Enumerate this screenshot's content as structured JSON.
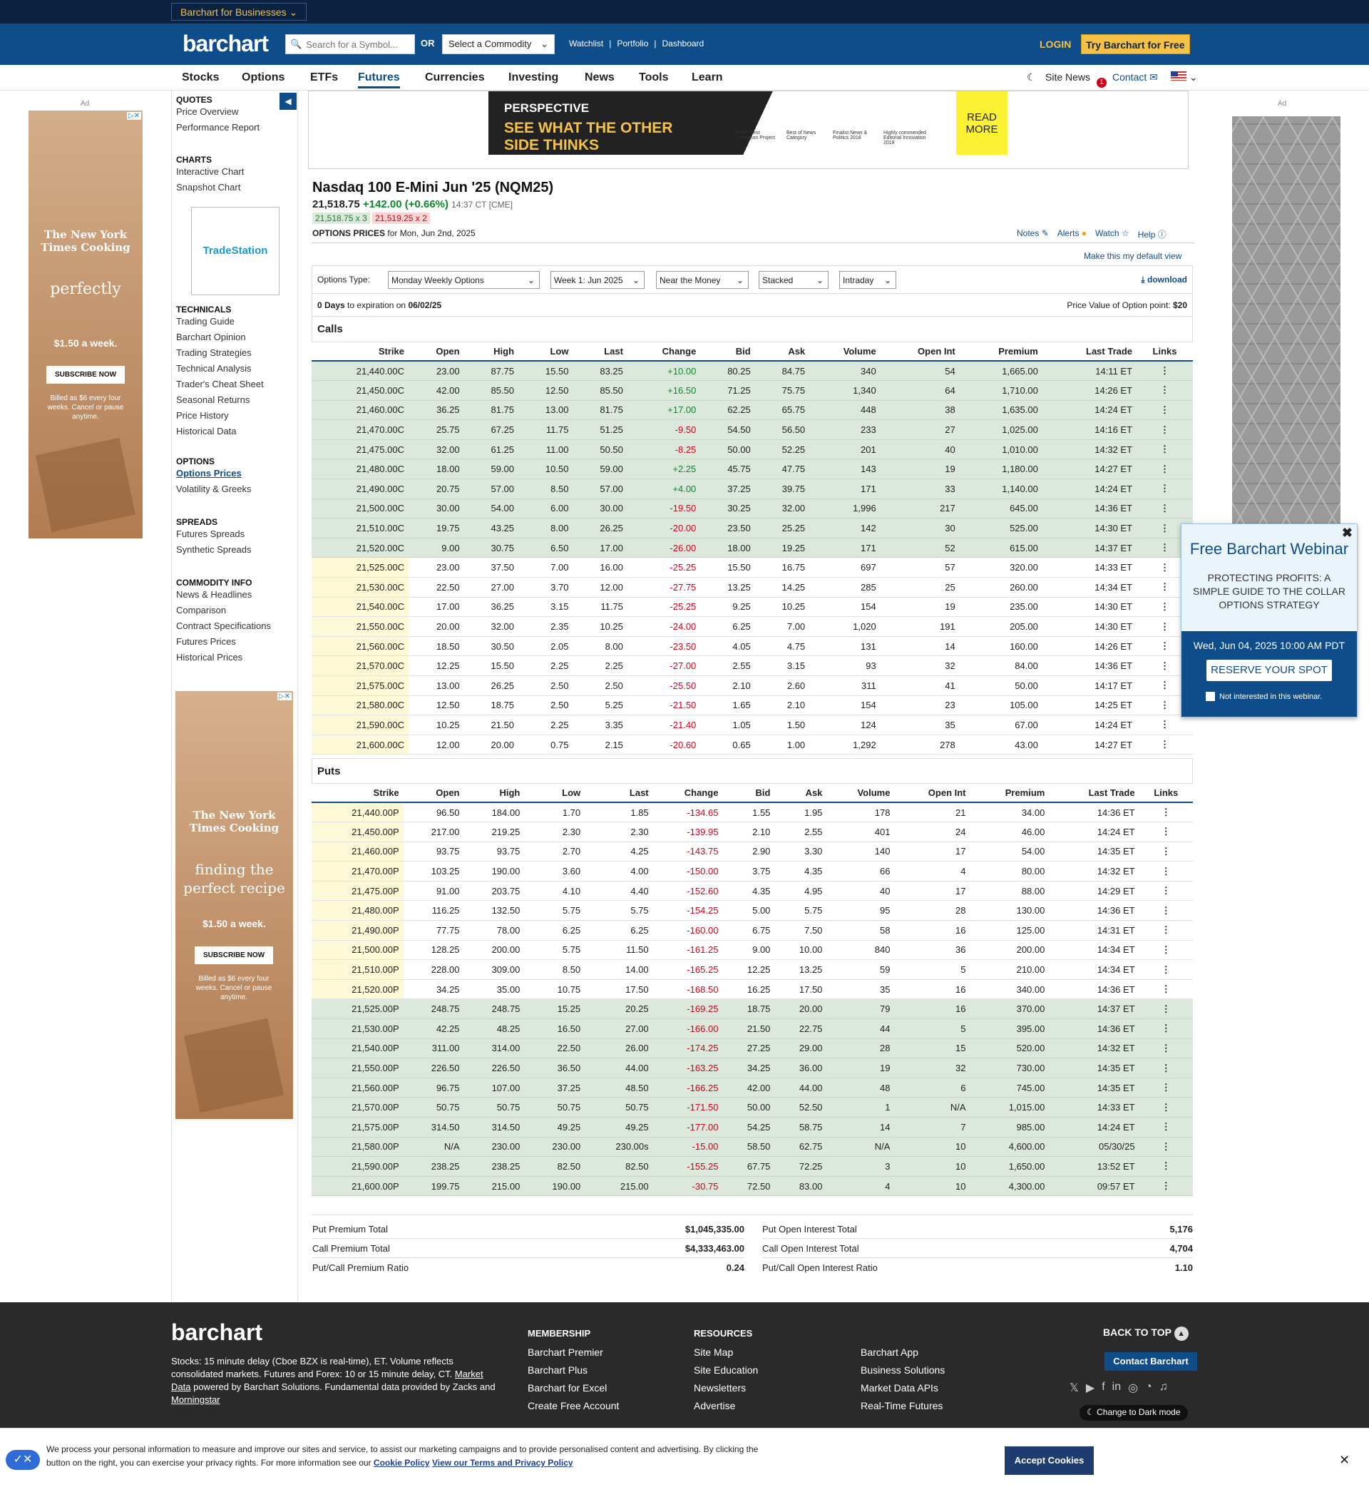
{
  "topbar": {
    "business_label": "Barchart for Businesses"
  },
  "header": {
    "logo": "barchart",
    "search_placeholder": "Search for a Symbol...",
    "or_label": "OR",
    "commodity_select": "Select a Commodity",
    "links": [
      "Watchlist",
      "Portfolio",
      "Dashboard"
    ],
    "login": "LOGIN",
    "try_free": "Try Barchart for Free"
  },
  "nav": {
    "items": [
      "Stocks",
      "Options",
      "ETFs",
      "Futures",
      "Currencies",
      "Investing",
      "News",
      "Tools",
      "Learn"
    ],
    "site_news": "Site News",
    "site_news_badge": "1",
    "contact": "Contact"
  },
  "ads": {
    "label": "Ad",
    "left_brand": "The New York Times Cooking",
    "left_word": "perfectly",
    "left_price": "$1.50 a week.",
    "left_subscribe": "SUBSCRIBE NOW",
    "left_billed": "Billed as $6 every four weeks. Cancel or pause anytime.",
    "mid_brand": "The New York Times Cooking",
    "mid_word1": "finding the",
    "mid_word2": "perfect recipe",
    "mid_price": "$1.50 a week.",
    "mid_subscribe": "SUBSCRIBE NOW",
    "mid_billed": "Billed as $6 every four weeks. Cancel or pause anytime.",
    "tradestation": "TradeStation",
    "banner_brand": "PERSPECTIVE",
    "banner_line1": "SEE WHAT THE OTHER",
    "banner_line2": "SIDE THINKS",
    "banner_awards": [
      "EPPY Best Innovation Project",
      "Best of News Category",
      "Finalist News & Politics 2018",
      "Highly commended Editorial Innovation 2018"
    ],
    "banner_cta": "READ MORE"
  },
  "sidebar": {
    "sections": [
      {
        "title": "QUOTES",
        "items": [
          "Price Overview",
          "Performance Report"
        ]
      },
      {
        "title": "CHARTS",
        "items": [
          "Interactive Chart",
          "Snapshot Chart"
        ]
      },
      {
        "title": "TECHNICALS",
        "items": [
          "Trading Guide",
          "Barchart Opinion",
          "Trading Strategies",
          "Technical Analysis",
          "Trader's Cheat Sheet",
          "Seasonal Returns",
          "Price History",
          "Historical Data"
        ]
      },
      {
        "title": "OPTIONS",
        "items": [
          "Options Prices",
          "Volatility & Greeks"
        ]
      },
      {
        "title": "SPREADS",
        "items": [
          "Futures Spreads",
          "Synthetic Spreads"
        ]
      },
      {
        "title": "COMMODITY INFO",
        "items": [
          "News & Headlines",
          "Comparison",
          "Contract Specifications",
          "Futures Prices",
          "Historical Prices"
        ]
      }
    ]
  },
  "quote": {
    "title": "Nasdaq 100 E-Mini Jun '25 (NQM25)",
    "price": "21,518.75",
    "change": "+142.00 (+0.66%)",
    "time": "14:37 CT [CME]",
    "bid": "21,518.75 x 3",
    "ask": "21,519.25 x 2",
    "options_prices_label": "OPTIONS PRICES",
    "options_date": "for Mon, Jun 2nd, 2025",
    "tools": [
      "Notes",
      "Alerts",
      "Watch",
      "Help"
    ],
    "default_view": "Make this my default view"
  },
  "filters": {
    "type_label": "Options Type:",
    "type": "Monday Weekly Options",
    "expiry": "Week 1: Jun 2025",
    "money": "Near the Money",
    "layout": "Stacked",
    "interval": "Intraday",
    "download": "download",
    "days": "0 Days",
    "expiration_text": "to expiration on",
    "expiration_date": "06/02/25",
    "price_value_label": "Price Value of Option point:",
    "price_value": "$20"
  },
  "calls": {
    "title": "Calls",
    "headers": [
      "Strike",
      "Open",
      "High",
      "Low",
      "Last",
      "Change",
      "Bid",
      "Ask",
      "Volume",
      "Open Int",
      "Premium",
      "Last Trade",
      "Links"
    ],
    "rows": [
      [
        "21,440.00C",
        "23.00",
        "87.75",
        "15.50",
        "83.25",
        "+10.00",
        "80.25",
        "84.75",
        "340",
        "54",
        "1,665.00",
        "14:11 ET"
      ],
      [
        "21,450.00C",
        "42.00",
        "85.50",
        "12.50",
        "85.50",
        "+16.50",
        "71.25",
        "75.75",
        "1,340",
        "64",
        "1,710.00",
        "14:26 ET"
      ],
      [
        "21,460.00C",
        "36.25",
        "81.75",
        "13.00",
        "81.75",
        "+17.00",
        "62.25",
        "65.75",
        "448",
        "38",
        "1,635.00",
        "14:24 ET"
      ],
      [
        "21,470.00C",
        "25.75",
        "67.25",
        "11.75",
        "51.25",
        "-9.50",
        "54.50",
        "56.50",
        "233",
        "27",
        "1,025.00",
        "14:16 ET"
      ],
      [
        "21,475.00C",
        "32.00",
        "61.25",
        "11.00",
        "50.50",
        "-8.25",
        "50.00",
        "52.25",
        "201",
        "40",
        "1,010.00",
        "14:32 ET"
      ],
      [
        "21,480.00C",
        "18.00",
        "59.00",
        "10.50",
        "59.00",
        "+2.25",
        "45.75",
        "47.75",
        "143",
        "19",
        "1,180.00",
        "14:27 ET"
      ],
      [
        "21,490.00C",
        "20.75",
        "57.00",
        "8.50",
        "57.00",
        "+4.00",
        "37.25",
        "39.75",
        "171",
        "33",
        "1,140.00",
        "14:24 ET"
      ],
      [
        "21,500.00C",
        "30.00",
        "54.00",
        "6.00",
        "30.00",
        "-19.50",
        "30.25",
        "32.00",
        "1,996",
        "217",
        "645.00",
        "14:36 ET"
      ],
      [
        "21,510.00C",
        "19.75",
        "43.25",
        "8.00",
        "26.25",
        "-20.00",
        "23.50",
        "25.25",
        "142",
        "30",
        "525.00",
        "14:30 ET"
      ],
      [
        "21,520.00C",
        "9.00",
        "30.75",
        "6.50",
        "17.00",
        "-26.00",
        "18.00",
        "19.25",
        "171",
        "52",
        "615.00",
        "14:37 ET"
      ],
      [
        "21,525.00C",
        "23.00",
        "37.50",
        "7.00",
        "16.00",
        "-25.25",
        "15.50",
        "16.75",
        "697",
        "57",
        "320.00",
        "14:33 ET"
      ],
      [
        "21,530.00C",
        "22.50",
        "27.00",
        "3.70",
        "12.00",
        "-27.75",
        "13.25",
        "14.25",
        "285",
        "25",
        "260.00",
        "14:34 ET"
      ],
      [
        "21,540.00C",
        "17.00",
        "36.25",
        "3.15",
        "11.75",
        "-25.25",
        "9.25",
        "10.25",
        "154",
        "19",
        "235.00",
        "14:30 ET"
      ],
      [
        "21,550.00C",
        "20.00",
        "32.00",
        "2.35",
        "10.25",
        "-24.00",
        "6.25",
        "7.00",
        "1,020",
        "191",
        "205.00",
        "14:30 ET"
      ],
      [
        "21,560.00C",
        "18.50",
        "30.50",
        "2.05",
        "8.00",
        "-23.50",
        "4.05",
        "4.75",
        "131",
        "14",
        "160.00",
        "14:26 ET"
      ],
      [
        "21,570.00C",
        "12.25",
        "15.50",
        "2.25",
        "2.25",
        "-27.00",
        "2.55",
        "3.15",
        "93",
        "32",
        "84.00",
        "14:36 ET"
      ],
      [
        "21,575.00C",
        "13.00",
        "26.25",
        "2.50",
        "2.50",
        "-25.50",
        "2.10",
        "2.60",
        "311",
        "41",
        "50.00",
        "14:17 ET"
      ],
      [
        "21,580.00C",
        "12.50",
        "18.75",
        "2.50",
        "5.25",
        "-21.50",
        "1.65",
        "2.10",
        "154",
        "23",
        "105.00",
        "14:25 ET"
      ],
      [
        "21,590.00C",
        "10.25",
        "21.50",
        "2.25",
        "3.35",
        "-21.40",
        "1.05",
        "1.50",
        "124",
        "35",
        "67.00",
        "14:24 ET"
      ],
      [
        "21,600.00C",
        "12.00",
        "20.00",
        "0.75",
        "2.15",
        "-20.60",
        "0.65",
        "1.00",
        "1,292",
        "278",
        "43.00",
        "14:27 ET"
      ]
    ]
  },
  "puts": {
    "title": "Puts",
    "headers": [
      "Strike",
      "Open",
      "High",
      "Low",
      "Last",
      "Change",
      "Bid",
      "Ask",
      "Volume",
      "Open Int",
      "Premium",
      "Last Trade",
      "Links"
    ],
    "rows": [
      [
        "21,440.00P",
        "96.50",
        "184.00",
        "1.70",
        "1.85",
        "-134.65",
        "1.55",
        "1.95",
        "178",
        "21",
        "34.00",
        "14:36 ET"
      ],
      [
        "21,450.00P",
        "217.00",
        "219.25",
        "2.30",
        "2.30",
        "-139.95",
        "2.10",
        "2.55",
        "401",
        "24",
        "46.00",
        "14:24 ET"
      ],
      [
        "21,460.00P",
        "93.75",
        "93.75",
        "2.70",
        "4.25",
        "-143.75",
        "2.90",
        "3.30",
        "140",
        "17",
        "54.00",
        "14:35 ET"
      ],
      [
        "21,470.00P",
        "103.25",
        "190.00",
        "3.60",
        "4.00",
        "-150.00",
        "3.75",
        "4.35",
        "66",
        "4",
        "80.00",
        "14:32 ET"
      ],
      [
        "21,475.00P",
        "91.00",
        "203.75",
        "4.10",
        "4.40",
        "-152.60",
        "4.35",
        "4.95",
        "40",
        "17",
        "88.00",
        "14:29 ET"
      ],
      [
        "21,480.00P",
        "116.25",
        "132.50",
        "5.75",
        "5.75",
        "-154.25",
        "5.00",
        "5.75",
        "95",
        "28",
        "130.00",
        "14:36 ET"
      ],
      [
        "21,490.00P",
        "77.75",
        "78.00",
        "6.25",
        "6.25",
        "-160.00",
        "6.75",
        "7.50",
        "58",
        "16",
        "125.00",
        "14:31 ET"
      ],
      [
        "21,500.00P",
        "128.25",
        "200.00",
        "5.75",
        "11.50",
        "-161.25",
        "9.00",
        "10.00",
        "840",
        "36",
        "200.00",
        "14:34 ET"
      ],
      [
        "21,510.00P",
        "228.00",
        "309.00",
        "8.50",
        "14.00",
        "-165.25",
        "12.25",
        "13.25",
        "59",
        "5",
        "210.00",
        "14:34 ET"
      ],
      [
        "21,520.00P",
        "34.25",
        "35.00",
        "10.75",
        "17.50",
        "-168.50",
        "16.25",
        "17.50",
        "35",
        "16",
        "340.00",
        "14:36 ET"
      ],
      [
        "21,525.00P",
        "248.75",
        "248.75",
        "15.25",
        "20.25",
        "-169.25",
        "18.75",
        "20.00",
        "79",
        "16",
        "370.00",
        "14:37 ET"
      ],
      [
        "21,530.00P",
        "42.25",
        "48.25",
        "16.50",
        "27.00",
        "-166.00",
        "21.50",
        "22.75",
        "44",
        "5",
        "395.00",
        "14:36 ET"
      ],
      [
        "21,540.00P",
        "311.00",
        "314.00",
        "22.50",
        "26.00",
        "-174.25",
        "27.25",
        "29.00",
        "28",
        "15",
        "520.00",
        "14:32 ET"
      ],
      [
        "21,550.00P",
        "226.50",
        "226.50",
        "36.50",
        "44.00",
        "-163.25",
        "34.25",
        "36.00",
        "19",
        "32",
        "730.00",
        "14:35 ET"
      ],
      [
        "21,560.00P",
        "96.75",
        "107.00",
        "37.25",
        "48.50",
        "-166.25",
        "42.00",
        "44.00",
        "48",
        "6",
        "745.00",
        "14:35 ET"
      ],
      [
        "21,570.00P",
        "50.75",
        "50.75",
        "50.75",
        "50.75",
        "-171.50",
        "50.00",
        "52.50",
        "1",
        "N/A",
        "1,015.00",
        "14:33 ET"
      ],
      [
        "21,575.00P",
        "314.50",
        "314.50",
        "49.25",
        "49.25",
        "-177.00",
        "54.25",
        "58.75",
        "14",
        "7",
        "985.00",
        "14:24 ET"
      ],
      [
        "21,580.00P",
        "N/A",
        "230.00",
        "230.00",
        "230.00s",
        "-15.00",
        "58.50",
        "62.75",
        "N/A",
        "10",
        "4,600.00",
        "05/30/25"
      ],
      [
        "21,590.00P",
        "238.25",
        "238.25",
        "82.50",
        "82.50",
        "-155.25",
        "67.75",
        "72.25",
        "3",
        "10",
        "1,650.00",
        "13:52 ET"
      ],
      [
        "21,600.00P",
        "199.75",
        "215.00",
        "190.00",
        "215.00",
        "-30.75",
        "72.50",
        "83.00",
        "4",
        "10",
        "4,300.00",
        "09:57 ET"
      ]
    ]
  },
  "summary": {
    "put_premium_label": "Put Premium Total",
    "put_premium": "$1,045,335.00",
    "call_premium_label": "Call Premium Total",
    "call_premium": "$4,333,463.00",
    "pc_premium_label": "Put/Call Premium Ratio",
    "pc_premium": "0.24",
    "put_oi_label": "Put Open Interest Total",
    "put_oi": "5,176",
    "call_oi_label": "Call Open Interest Total",
    "call_oi": "4,704",
    "pc_oi_label": "Put/Call Open Interest Ratio",
    "pc_oi": "1.10"
  },
  "webinar": {
    "title": "Free Barchart Webinar",
    "subtitle": "PROTECTING PROFITS: A SIMPLE GUIDE TO THE COLLAR OPTIONS STRATEGY",
    "date": "Wed, Jun 04, 2025 10:00 AM PDT",
    "cta": "RESERVE YOUR SPOT",
    "optout": "Not interested in this webinar."
  },
  "footer": {
    "logo": "barchart",
    "disclaimer_part1": "Stocks: 15 minute delay (Cboe BZX is real-time), ET. Volume reflects consolidated markets. Futures and Forex: 10 or 15 minute delay, CT.",
    "market_data": "Market Data",
    "disclaimer_part2": "powered by Barchart Solutions. Fundamental data provided by Zacks and",
    "morningstar": "Morningstar",
    "membership_title": "MEMBERSHIP",
    "membership": [
      "Barchart Premier",
      "Barchart Plus",
      "Barchart for Excel",
      "Create Free Account"
    ],
    "resources_title": "RESOURCES",
    "resources": [
      "Site Map",
      "Site Education",
      "Newsletters",
      "Advertise"
    ],
    "more": [
      "Barchart App",
      "Business Solutions",
      "Market Data APIs",
      "Real-Time Futures"
    ],
    "back_to_top": "BACK TO TOP",
    "contact": "Contact Barchart",
    "dark_mode": "Change to Dark mode"
  },
  "cookie": {
    "text": "We process your personal information to measure and improve our sites and service, to assist our marketing campaigns and to provide personalised content and advertising. By clicking the button on the right, you can exercise your privacy rights. For more information see our",
    "cookie_policy": "Cookie Policy",
    "terms": "View our Terms and Privacy Policy",
    "accept": "Accept Cookies"
  }
}
